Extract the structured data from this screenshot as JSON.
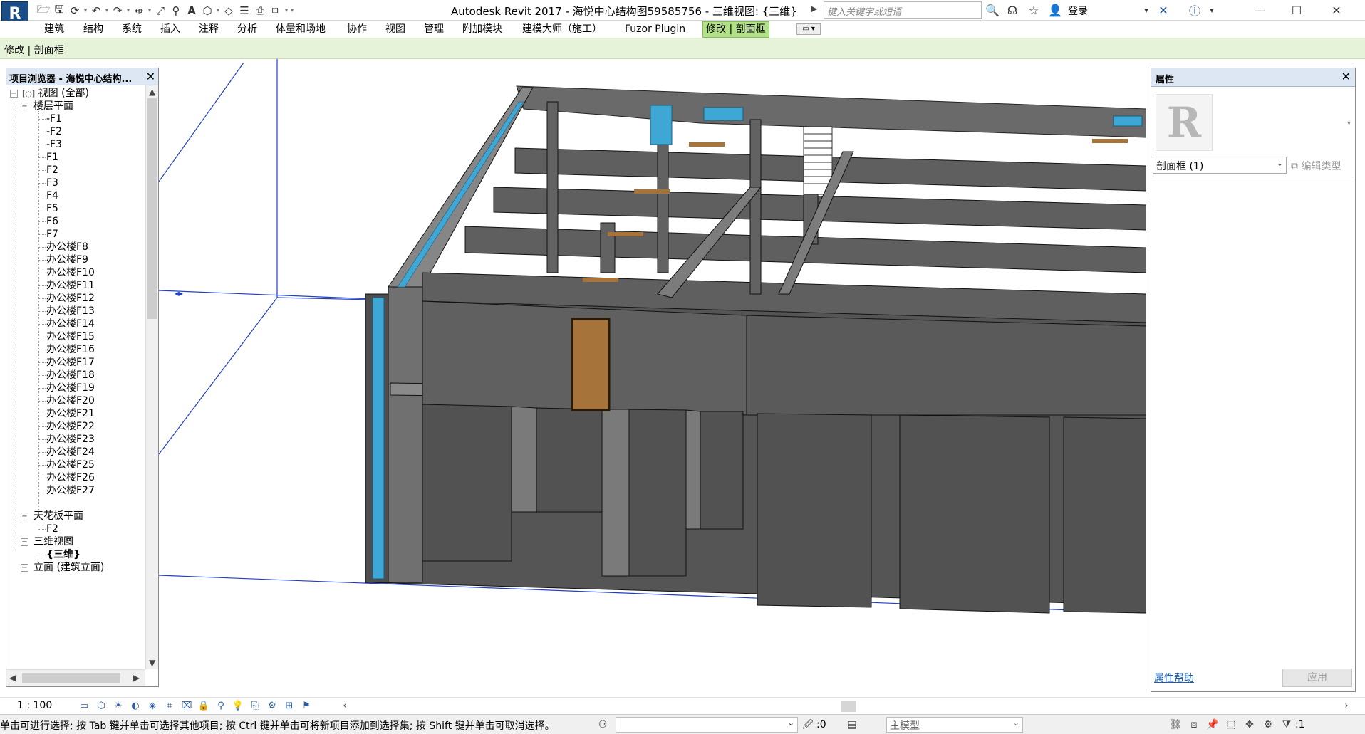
{
  "window": {
    "title": "Autodesk Revit 2017 -    海悦中心结构图59585756 - 三维视图: {三维}",
    "search_placeholder": "键入关键字或短语",
    "login_label": "登录",
    "app_button_label": "R"
  },
  "ribbon": {
    "tabs": [
      {
        "label": "建筑"
      },
      {
        "label": "结构"
      },
      {
        "label": "系统"
      },
      {
        "label": "插入"
      },
      {
        "label": "注释"
      },
      {
        "label": "分析"
      },
      {
        "label": "体量和场地"
      },
      {
        "label": "协作"
      },
      {
        "label": "视图"
      },
      {
        "label": "管理"
      },
      {
        "label": "附加模块"
      },
      {
        "label": "建模大师（施工）"
      },
      {
        "label": "Fuzor Plugin"
      },
      {
        "label": "修改 | 剖面框"
      }
    ],
    "context_label": "修改 | 剖面框"
  },
  "project_browser": {
    "title": "项目浏览器 - 海悦中心结构...",
    "root": "视图 (全部)",
    "floor_plans_label": "楼层平面",
    "floor_plans": [
      "-F1",
      "-F2",
      "-F3",
      "F1",
      "F2",
      "F3",
      "F4",
      "F5",
      "F6",
      "F7",
      "办公楼F8",
      "办公楼F9",
      "办公楼F10",
      "办公楼F11",
      "办公楼F12",
      "办公楼F13",
      "办公楼F14",
      "办公楼F15",
      "办公楼F16",
      "办公楼F17",
      "办公楼F18",
      "办公楼F19",
      "办公楼F20",
      "办公楼F21",
      "办公楼F22",
      "办公楼F23",
      "办公楼F24",
      "办公楼F25",
      "办公楼F26",
      "办公楼F27"
    ],
    "ceiling_label": "天花板平面",
    "ceiling_plans": [
      "F2"
    ],
    "threed_label": "三维视图",
    "threed_views": [
      "{三维}"
    ],
    "elevation_label": "立面 (建筑立面)"
  },
  "properties": {
    "title": "属性",
    "type_image_letter": "R",
    "instance": "剖面框 (1)",
    "edit_type": "编辑类型",
    "help_link": "属性帮助",
    "apply": "应用"
  },
  "view_bar": {
    "scale": "1 : 100"
  },
  "status_bar": {
    "message": "单击可进行选择; 按 Tab 键并单击可选择其他项目; 按 Ctrl 键并单击可将新项目添加到选择集; 按 Shift 键并单击可取消选择。",
    "workset_count": ":0",
    "model_label": "主模型",
    "filter_count": ":1"
  },
  "colors": {
    "ribbon_active": "#b3e18a",
    "context_bar": "#e6f3d8",
    "panel_header": "#dde7f3",
    "section_box": "#1f3fc8",
    "wall_gray": "#5b5b5b",
    "glass_blue": "#3fa7d6",
    "door_brown": "#a6743a"
  }
}
